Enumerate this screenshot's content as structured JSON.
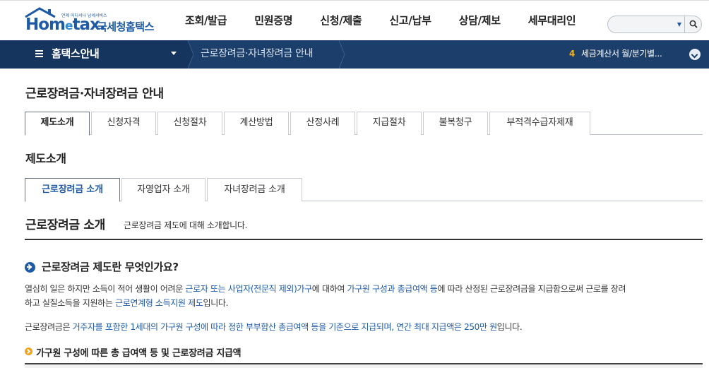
{
  "header": {
    "logo_small": "언제 어디서나 납세서비스",
    "logo_word_a": "Hom",
    "logo_word_e": "e",
    "logo_word_b": "tax.",
    "logo_kor": "국세청홈택스",
    "gnb": [
      "조회/발급",
      "민원증명",
      "신청/제출",
      "신고/납부",
      "상담/제보",
      "세무대리인"
    ],
    "search": {
      "value": "",
      "placeholder": ""
    }
  },
  "location": {
    "menu_title": "홈택스안내",
    "breadcrumb": "근로장려금·자녀장려금 안내",
    "notice_number": "4",
    "notice_text": "세금계산서 월/분기별..."
  },
  "page": {
    "title": "근로장려금·자녀장려금 안내",
    "tabs": [
      {
        "label": "제도소개",
        "active": true
      },
      {
        "label": "신청자격",
        "active": false
      },
      {
        "label": "신청절차",
        "active": false
      },
      {
        "label": "계산방법",
        "active": false
      },
      {
        "label": "산정사례",
        "active": false
      },
      {
        "label": "지급절차",
        "active": false
      },
      {
        "label": "불복청구",
        "active": false
      },
      {
        "label": "부적격수급자제재",
        "active": false
      }
    ],
    "section_title": "제도소개",
    "subtabs": [
      {
        "label": "근로장려금 소개",
        "active": true
      },
      {
        "label": "자영업자 소개",
        "active": false
      },
      {
        "label": "자녀장려금 소개",
        "active": false
      }
    ],
    "intro_title": "근로장려금 소개",
    "intro_desc": "근로장려금 제도에 대해 소개합니다.",
    "question": "근로장려금 제도란 무엇인가요?",
    "para1": {
      "t1": "열심히 일은 하지만 소득이 적어 생활이 어려운 ",
      "h1": "근로자 또는 사업자(전문직 제외)가구",
      "t2": "에 대하여 ",
      "h2": "가구원 구성과 총급여액 등",
      "t3": "에 따라 산정된 근로장려금을 지급함으로써 근로를 장려",
      "t4": "하고 실질소득을 지원하는 ",
      "h3": "근로연계형 소득지원 제도",
      "t5": "입니다."
    },
    "para2": {
      "t1": "근로장려금은 ",
      "h1": "거주자를 포함한 1세대의 가구원 구성에 따라 정한 부부합산 총급여액 등을 기준으로 지급되며, 연간 최대 지급액은 250만 원",
      "t2": "입니다."
    },
    "subheading": "가구원 구성에 따른 총 급여액 등 및 근로장려금 지급액"
  },
  "colors": {
    "brand_blue": "#1f5aa6",
    "location_bar": "#1c3e6b",
    "notice_accent": "#f7b21b",
    "bullet_orange": "#f0a31c"
  }
}
